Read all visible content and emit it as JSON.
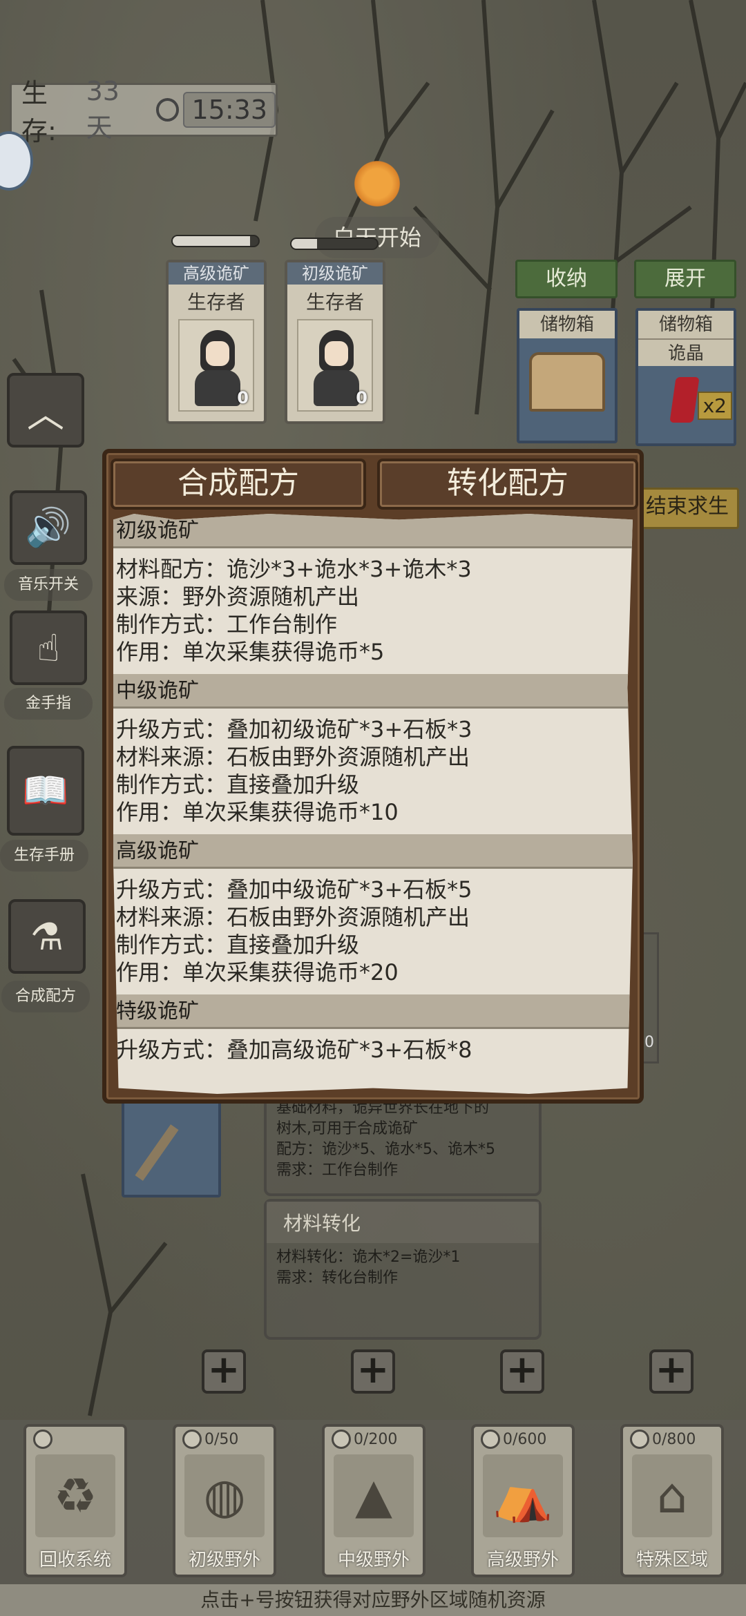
{
  "status": {
    "survive_label": "生存:",
    "days": "33天",
    "time": "15:33"
  },
  "day_event": "白天开始",
  "characters": [
    {
      "tag": "高级诡矿",
      "role": "生存者",
      "count": "0",
      "hp": 0.9
    },
    {
      "tag": "初级诡矿",
      "role": "生存者",
      "count": "0",
      "hp": 0.3
    }
  ],
  "storage": {
    "collapse_btn": "收纳",
    "expand_btn": "展开",
    "box1_title": "储物箱",
    "box2_title": "储物箱",
    "box2_item": "诡晶",
    "box2_qty": "x2",
    "end_btn": "结束求生"
  },
  "side_menu": [
    {
      "label": "音乐开关"
    },
    {
      "label": "金手指"
    },
    {
      "label": "生存手册"
    },
    {
      "label": "合成配方"
    }
  ],
  "dialog": {
    "tabs": [
      "合成配方",
      "转化配方"
    ],
    "sections": [
      {
        "title": "初级诡矿",
        "lines": [
          "材料配方：诡沙*3+诡水*3+诡木*3",
          "来源：野外资源随机产出",
          "制作方式：工作台制作",
          "作用：单次采集获得诡币*5"
        ]
      },
      {
        "title": "中级诡矿",
        "lines": [
          "升级方式：叠加初级诡矿*3+石板*3",
          "材料来源：石板由野外资源随机产出",
          "制作方式：直接叠加升级",
          "作用：单次采集获得诡币*10"
        ]
      },
      {
        "title": "高级诡矿",
        "lines": [
          "升级方式：叠加中级诡矿*3+石板*5",
          "材料来源：石板由野外资源随机产出",
          "制作方式：直接叠加升级",
          "作用：单次采集获得诡币*20"
        ]
      },
      {
        "title": "特级诡矿",
        "lines": [
          "升级方式：叠加高级诡矿*3+石板*8"
        ]
      }
    ]
  },
  "lower_panels": {
    "panel1_lines": [
      "基础材料，诡异世界长在地下的",
      "树木,可用于合成诡矿",
      "配方：诡沙*5、诡水*5、诡木*5",
      "需求：工作台制作"
    ],
    "panel2_title": "材料转化",
    "panel2_lines": [
      "材料转化：诡木*2=诡沙*1",
      "需求：转化台制作"
    ],
    "side_count": "0"
  },
  "dock": [
    {
      "label": "回收系统",
      "cost": ""
    },
    {
      "label": "初级野外",
      "cost": "0/50"
    },
    {
      "label": "中级野外",
      "cost": "0/200"
    },
    {
      "label": "高级野外",
      "cost": "0/600"
    },
    {
      "label": "特殊区域",
      "cost": "0/800"
    }
  ],
  "hint": "点击+号按钮获得对应野外区域随机资源"
}
